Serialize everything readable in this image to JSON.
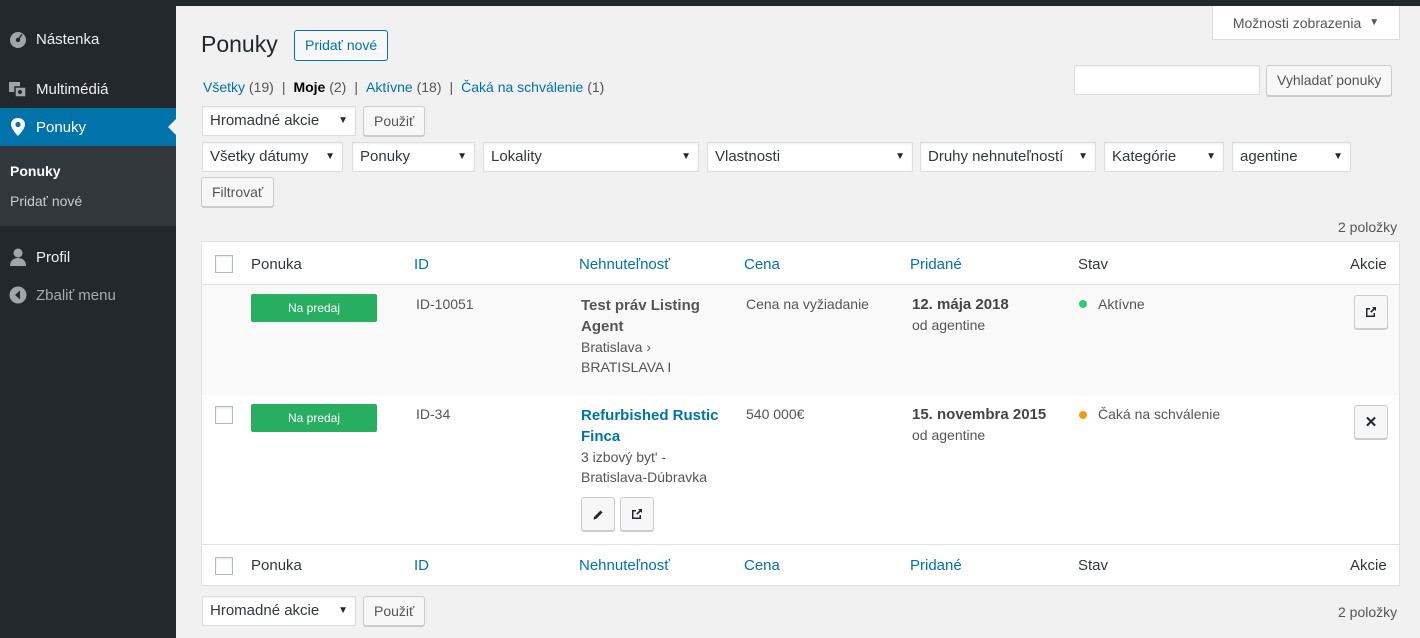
{
  "sidebar": {
    "items": [
      {
        "label": "Nástenka",
        "icon": "dashboard-icon"
      },
      {
        "label": "Multimédiá",
        "icon": "media-icon"
      },
      {
        "label": "Ponuky",
        "icon": "location-pin-icon"
      },
      {
        "label": "Profil",
        "icon": "user-icon"
      },
      {
        "label": "Zbaliť menu",
        "icon": "collapse-icon"
      }
    ],
    "submenu": [
      "Ponuky",
      "Pridať nové"
    ]
  },
  "header": {
    "title": "Ponuky",
    "add_new": "Pridať nové",
    "screen_options": "Možnosti zobrazenia"
  },
  "views": [
    {
      "label": "Všetky",
      "count": "(19)"
    },
    {
      "label": "Moje",
      "count": "(2)"
    },
    {
      "label": "Aktívne",
      "count": "(18)"
    },
    {
      "label": "Čaká na schválenie",
      "count": "(1)"
    }
  ],
  "search": {
    "button": "Vyhladať ponuky",
    "value": ""
  },
  "bulk": {
    "select": "Hromadné akcie",
    "apply": "Použiť"
  },
  "filters": {
    "dates": "Všetky dátumy",
    "offers": "Ponuky",
    "locations": "Lokality",
    "properties": "Vlastnosti",
    "types": "Druhy nehnuteľností",
    "categories": "Kategórie",
    "agent": "agentine",
    "button": "Filtrovať"
  },
  "items_count": "2 položky",
  "table": {
    "headers": {
      "offer": "Ponuka",
      "id": "ID",
      "property": "Nehnuteľnosť",
      "price": "Cena",
      "added": "Pridané",
      "status": "Stav",
      "actions": "Akcie"
    },
    "rows": [
      {
        "badge": "Na predaj",
        "id": "ID-10051",
        "title_l1": "Test práv Listing",
        "title_l2": "Agent",
        "loc_l1": "Bratislava ›",
        "loc_l2": "BRATISLAVA I",
        "price": "Cena na vyžiadanie",
        "date": "12. mája 2018",
        "by": "od agentine",
        "status": "Aktívne",
        "status_color": "#2ecc71"
      },
      {
        "badge": "Na predaj",
        "id": "ID-34",
        "title_l1": "Refurbished Rustic",
        "title_l2": "Finca",
        "loc_l1": "3 izbový byt' -",
        "loc_l2": "Bratislava-Dúbravka",
        "price": "540 000€",
        "date": "15. novembra 2015",
        "by": "od agentine",
        "status": "Čaká na schválenie",
        "status_color": "#f39c12"
      }
    ]
  },
  "colors": {
    "accent": "#0073aa",
    "sidebar": "#23282d",
    "badge": "#27ae60"
  }
}
